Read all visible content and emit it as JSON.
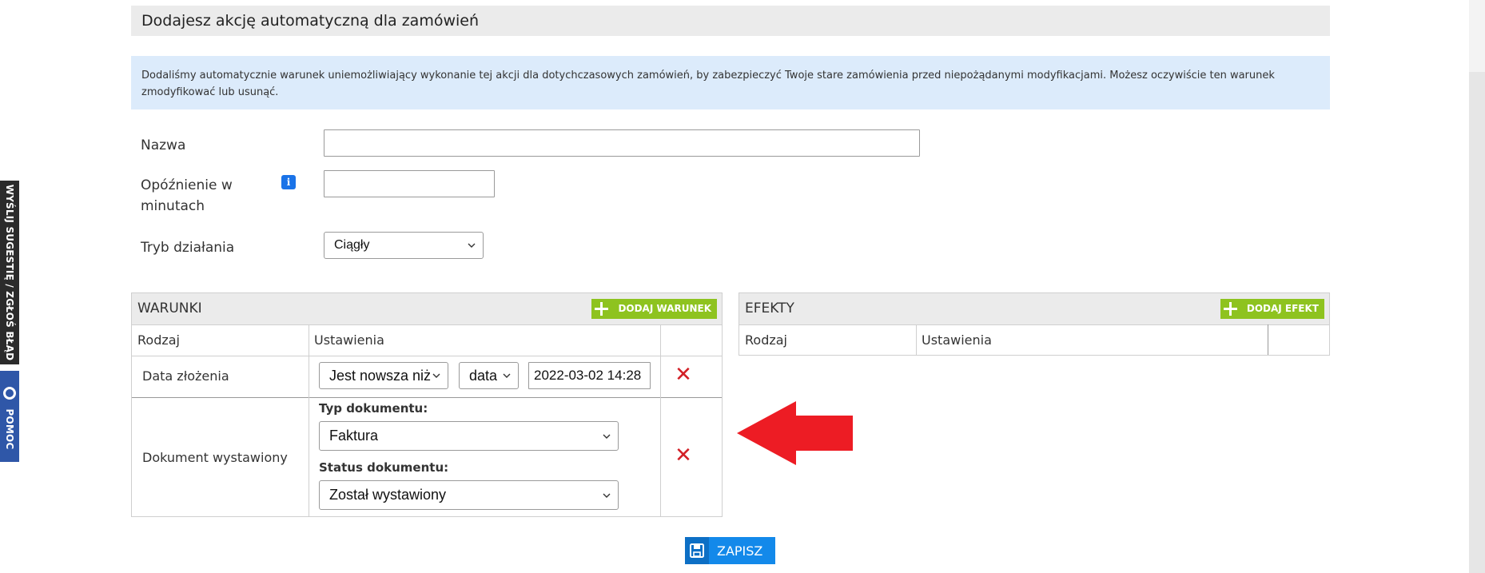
{
  "side_tabs": {
    "suggestion": "WYŚLIJ SUGESTIĘ / ZGŁOŚ BŁĄD",
    "help": "POMOC"
  },
  "header": {
    "title": "Dodajesz akcję automatyczną dla zamówień"
  },
  "info": {
    "text": "Dodaliśmy automatycznie warunek uniemożliwiający wykonanie tej akcji dla dotychczasowych zamówień, by zabezpieczyć Twoje stare zamówienia przed niepożądanymi modyfikacjami. Możesz oczywiście ten warunek zmodyfikować lub usunąć."
  },
  "form": {
    "name_label": "Nazwa",
    "name_value": "",
    "delay_label": "Opóźnienie w minutach",
    "delay_value": "",
    "mode_label": "Tryb działania",
    "mode_value": "Ciągły",
    "info_icon": "i"
  },
  "conditions": {
    "title": "WARUNKI",
    "add_button": "DODAJ WARUNEK",
    "col_type": "Rodzaj",
    "col_settings": "Ustawienia",
    "rows": [
      {
        "type": "Data złożenia",
        "operator": "Jest nowsza niż",
        "unit": "data",
        "value": "2022-03-02 14:28"
      },
      {
        "type": "Dokument wystawiony",
        "doc_type_label": "Typ dokumentu:",
        "doc_type_value": "Faktura",
        "doc_status_label": "Status dokumentu:",
        "doc_status_value": "Został wystawiony"
      }
    ],
    "delete_icon": "✕"
  },
  "effects": {
    "title": "EFEKTY",
    "add_button": "DODAJ EFEKT",
    "col_type": "Rodzaj",
    "col_settings": "Ustawienia"
  },
  "save_button": "ZAPISZ",
  "colors": {
    "accent_blue": "#1389ea",
    "accent_green": "#8ec31f",
    "delete_red": "#d21f26",
    "arrow_red": "#ed1c24",
    "info_bg": "#dcebfb"
  }
}
